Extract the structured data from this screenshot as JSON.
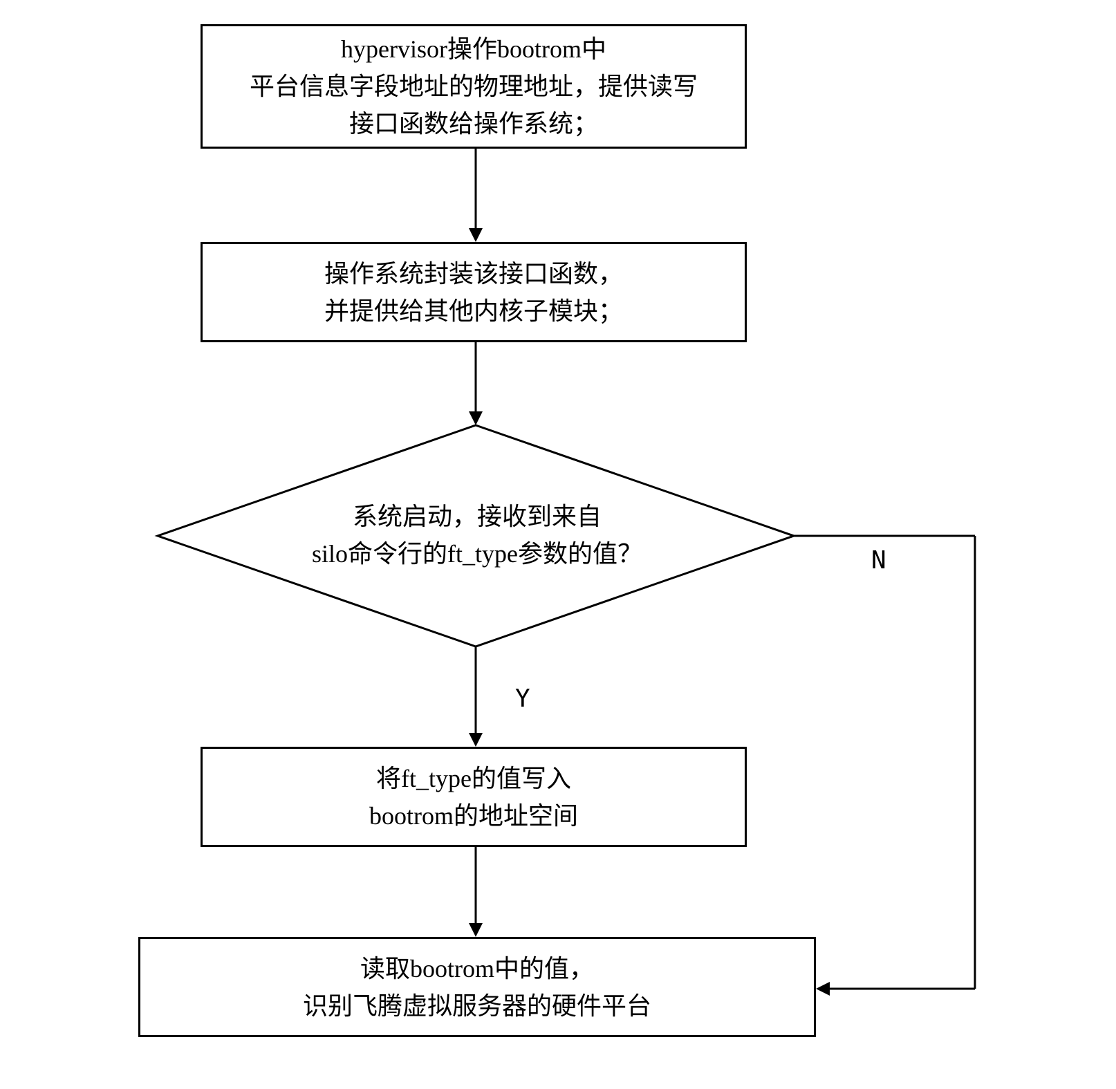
{
  "flowchart": {
    "box1": {
      "line1": "hypervisor操作bootrom中",
      "line2": "平台信息字段地址的物理地址，提供读写",
      "line3": "接口函数给操作系统；"
    },
    "box2": {
      "line1": "操作系统封装该接口函数，",
      "line2": "并提供给其他内核子模块；"
    },
    "decision": {
      "line1": "系统启动，接收到来自",
      "line2": "silo命令行的ft_type参数的值？"
    },
    "box3": {
      "line1": "将ft_type的值写入",
      "line2": "bootrom的地址空间"
    },
    "box4": {
      "line1": "读取bootrom中的值，",
      "line2": "识别飞腾虚拟服务器的硬件平台"
    },
    "labels": {
      "yes": "Y",
      "no": "N"
    }
  }
}
